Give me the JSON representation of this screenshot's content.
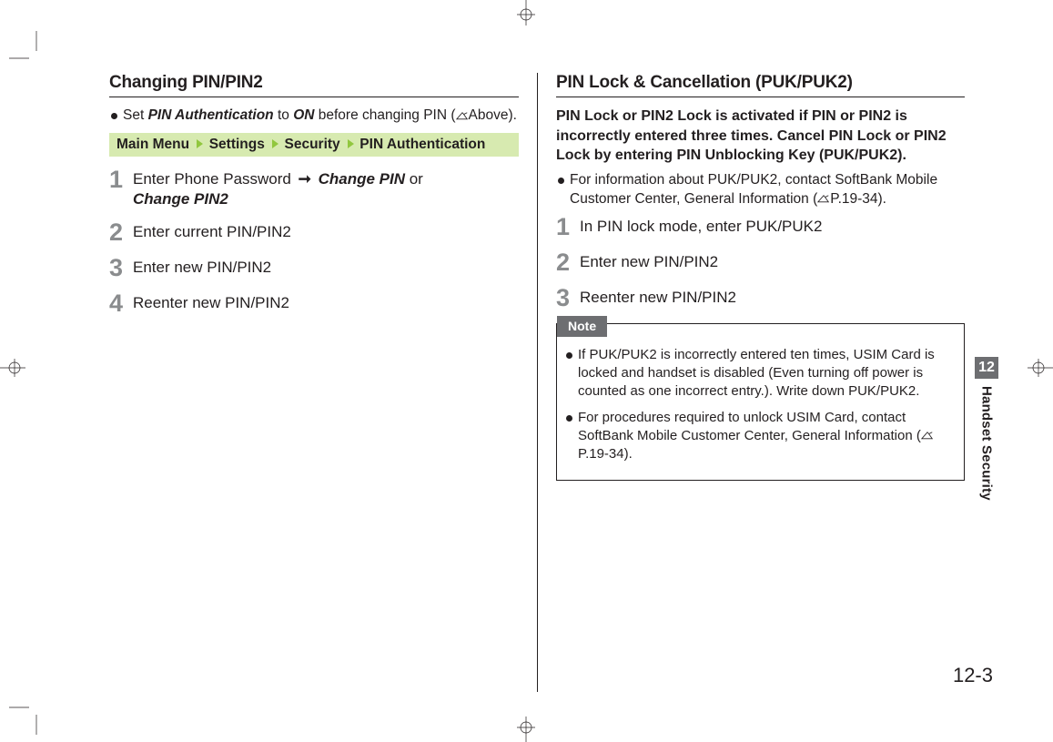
{
  "left": {
    "heading": "Changing PIN/PIN2",
    "intro_prefix": "Set ",
    "intro_item": "PIN Authentication",
    "intro_mid": " to ",
    "intro_on": "ON",
    "intro_suffix": " before changing PIN (",
    "intro_ref": "Above).",
    "breadcrumb": {
      "a": "Main Menu",
      "b": "Settings",
      "c": "Security",
      "d": "PIN Authentication"
    },
    "steps": {
      "s1_a": "Enter Phone Password ",
      "s1_b": "Change PIN",
      "s1_c": " or ",
      "s1_d": "Change PIN2",
      "s2": "Enter current PIN/PIN2",
      "s3": "Enter new PIN/PIN2",
      "s4": "Reenter new PIN/PIN2"
    }
  },
  "right": {
    "heading": "PIN Lock & Cancellation (PUK/PUK2)",
    "lead": "PIN Lock or PIN2 Lock is activated if PIN or PIN2 is incorrectly entered three times. Cancel PIN Lock or PIN2 Lock by entering PIN Unblocking Key (PUK/PUK2).",
    "info_a": "For information about PUK/PUK2, contact SoftBank Mobile Customer Center, General Information (",
    "info_b": "P.19-34).",
    "steps": {
      "s1": "In PIN lock mode, enter PUK/PUK2",
      "s2": "Enter new PIN/PIN2",
      "s3": "Reenter new PIN/PIN2"
    },
    "note_label": "Note",
    "note1": "If PUK/PUK2 is incorrectly entered ten times, USIM Card is locked and handset is disabled (Even turning off power is counted as one incorrect entry.). Write down PUK/PUK2.",
    "note2_a": "For procedures required to unlock USIM Card, contact SoftBank Mobile Customer Center, General Information (",
    "note2_b": "P.19-34)."
  },
  "side": {
    "chapter_num": "12",
    "chapter_title": "Handset Security"
  },
  "page_number": "12-3"
}
